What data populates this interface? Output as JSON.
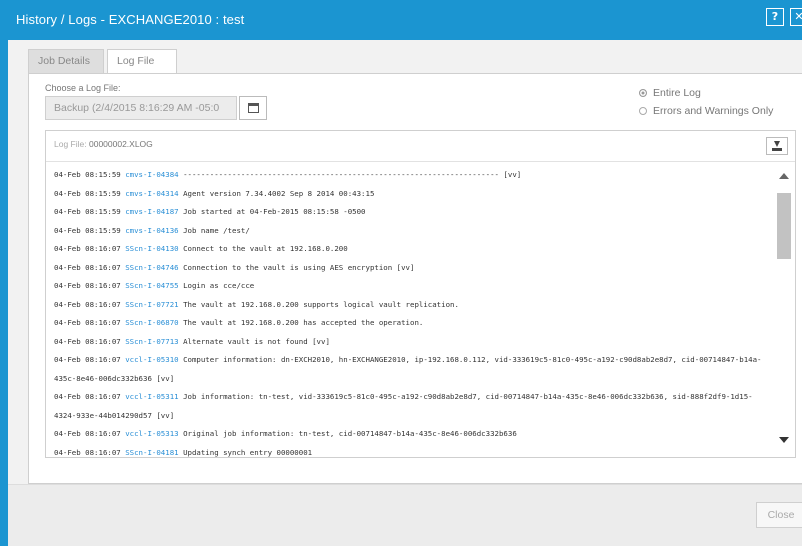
{
  "window": {
    "title": "History / Logs - EXCHANGE2010 : test",
    "help_label": "?",
    "close_label": "✕"
  },
  "tabs": [
    {
      "label": "Job Details",
      "active": false
    },
    {
      "label": "Log File",
      "active": true
    }
  ],
  "log_chooser": {
    "label": "Choose a Log File:",
    "selected": "Backup (2/4/2015 8:16:29 AM -05:0"
  },
  "scope_options": [
    {
      "label": "Entire Log",
      "selected": true
    },
    {
      "label": "Errors and Warnings Only",
      "selected": false
    }
  ],
  "log": {
    "file_label": "Log File:",
    "file_name": "00000002.XLOG",
    "lines": [
      {
        "ts": "04-Feb 08:15:59",
        "src": "cmvs-I-04384",
        "msg": "-----------------------------------------------------------------------  [vv]"
      },
      {
        "ts": "04-Feb 08:15:59",
        "src": "cmvs-I-04314",
        "msg": "Agent version 7.34.4002 Sep  8 2014 00:43:15"
      },
      {
        "ts": "04-Feb 08:15:59",
        "src": "cmvs-I-04187",
        "msg": "Job started at 04-Feb-2015 08:15:58 -0500"
      },
      {
        "ts": "04-Feb 08:15:59",
        "src": "cmvs-I-04136",
        "msg": "Job name /test/"
      },
      {
        "ts": "04-Feb 08:16:07",
        "src": "SScn-I-04130",
        "msg": "Connect to the vault at 192.168.0.200"
      },
      {
        "ts": "04-Feb 08:16:07",
        "src": "SScn-I-04746",
        "msg": "Connection to the vault is using AES encryption [vv]"
      },
      {
        "ts": "04-Feb 08:16:07",
        "src": "SScn-I-04755",
        "msg": "Login as cce/cce"
      },
      {
        "ts": "04-Feb 08:16:07",
        "src": "SScn-I-07721",
        "msg": "The vault at 192.168.0.200 supports logical vault replication."
      },
      {
        "ts": "04-Feb 08:16:07",
        "src": "SScn-I-06870",
        "msg": "The vault at 192.168.0.200 has accepted the operation."
      },
      {
        "ts": "04-Feb 08:16:07",
        "src": "SScn-I-07713",
        "msg": "Alternate vault is not found [vv]"
      },
      {
        "ts": "04-Feb 08:16:07",
        "src": "vccl-I-05310",
        "msg": "Computer information: dn-EXCH2010, hn-EXCHANGE2010, ip-192.168.0.112, vid-333619c5-81c0-495c-a192-c90d8ab2e8d7, cid-00714847-b14a-435c-8e46-006dc332b636 [vv]"
      },
      {
        "ts": "04-Feb 08:16:07",
        "src": "vccl-I-05311",
        "msg": "Job information: tn-test, vid-333619c5-81c0-495c-a192-c90d8ab2e8d7, cid-00714847-b14a-435c-8e46-006dc332b636, sid-888f2df9-1d15-4324-933e-44b014290d57 [vv]"
      },
      {
        "ts": "04-Feb 08:16:07",
        "src": "vccl-I-05313",
        "msg": "Original job information: tn-test, cid-00714847-b14a-435c-8e46-006dc332b636"
      },
      {
        "ts": "04-Feb 08:16:07",
        "src": "SScn-I-04181",
        "msg": "Updating synch entry 00000001"
      }
    ]
  },
  "footer": {
    "close_label": "Close"
  },
  "colors": {
    "accent": "#1b95d1",
    "source_link": "#2a8fd6"
  }
}
